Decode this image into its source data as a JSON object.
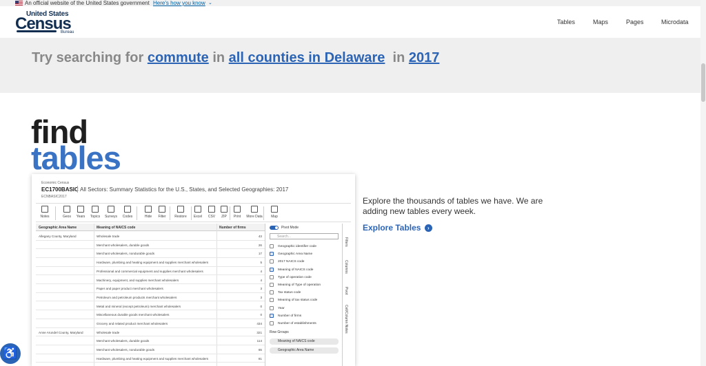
{
  "banner": {
    "text": "An official website of the United States government",
    "link": "Here's how you know",
    "chevron": "⌄"
  },
  "logo": {
    "line1": "United States",
    "line2": "Census",
    "line3": "Bureau"
  },
  "nav": [
    "Tables",
    "Maps",
    "Pages",
    "Microdata"
  ],
  "search_prompt": {
    "prefix": "Try searching for",
    "term": "commute",
    "in1": "in",
    "geo": "all counties in Delaware",
    "in2": "in",
    "year": "2017"
  },
  "hero": {
    "word1": "find",
    "word2": "tables"
  },
  "table_preview": {
    "program": "Economic Census",
    "code": "EC1700BASIC",
    "title": "All Sectors: Summary Statistics for the U.S., States, and Selected Geographies: 2017",
    "subcode": "ECNBASIC2017",
    "toolbar": [
      "Notes",
      "Geos",
      "Years",
      "Topics",
      "Surveys",
      "Codes",
      "Hide",
      "Filter",
      "Restore",
      "Excel",
      "CSV",
      "ZIP",
      "Print",
      "More Data",
      "Map"
    ],
    "columns": [
      "Geographic Area Name",
      "Meaning of NAICS code",
      "Number of firms"
    ],
    "rows": [
      {
        "geo": "Allegany County, Maryland",
        "naics": "Wholesale trade",
        "firms": "43"
      },
      {
        "geo": "",
        "naics": "Merchant wholesalers, durable goods",
        "firms": "26"
      },
      {
        "geo": "",
        "naics": "Merchant wholesalers, nondurable goods",
        "firms": "17"
      },
      {
        "geo": "",
        "naics": "Hardware, plumbing and heating equipment and supplies merchant wholesalers",
        "firms": "5"
      },
      {
        "geo": "",
        "naics": "Professional and commercial equipment and supplies merchant wholesalers",
        "firms": "4"
      },
      {
        "geo": "",
        "naics": "Machinery, equipment, and supplies merchant wholesalers",
        "firms": "4"
      },
      {
        "geo": "",
        "naics": "Paper and paper product merchant wholesalers",
        "firms": "3"
      },
      {
        "geo": "",
        "naics": "Petroleum and petroleum products merchant wholesalers",
        "firms": "3"
      },
      {
        "geo": "",
        "naics": "Metal and mineral (except petroleum) merchant wholesalers",
        "firms": "0"
      },
      {
        "geo": "",
        "naics": "Miscellaneous durable goods merchant wholesalers",
        "firms": "0"
      },
      {
        "geo": "",
        "naics": "Grocery and related product merchant wholesalers",
        "firms": "434"
      },
      {
        "geo": "Anne Arundel County, Maryland",
        "naics": "Wholesale trade",
        "firms": "321"
      },
      {
        "geo": "",
        "naics": "Merchant wholesalers, durable goods",
        "firms": "114"
      },
      {
        "geo": "",
        "naics": "Merchant wholesalers, nondurable goods",
        "firms": "65"
      },
      {
        "geo": "",
        "naics": "Hardware, plumbing and heating equipment and supplies merchant wholesalers",
        "firms": "81"
      }
    ],
    "panel": {
      "pivot": "Pivot Mode",
      "search_placeholder": "Search...",
      "fields": [
        {
          "label": "Geographic identifier code",
          "checked": false
        },
        {
          "label": "Geographic Area Name",
          "checked": true
        },
        {
          "label": "2017 NAICS code",
          "checked": false
        },
        {
          "label": "Meaning of NAICS code",
          "checked": true
        },
        {
          "label": "Type of operation code",
          "checked": false
        },
        {
          "label": "Meaning of Type of operation",
          "checked": false
        },
        {
          "label": "Tax status code",
          "checked": false
        },
        {
          "label": "Meaning of tax status code",
          "checked": false
        },
        {
          "label": "Year",
          "checked": false
        },
        {
          "label": "Number of firms",
          "checked": true
        },
        {
          "label": "Number of establishments",
          "checked": false
        }
      ],
      "row_groups_label": "Row Groups",
      "row_groups": [
        "Meaning of NAICS code",
        "Geographic Area Name"
      ]
    },
    "side_tabs": [
      "Filters",
      "Columns",
      "Pivot",
      "Cell/Column Notes"
    ]
  },
  "explore": {
    "description": "Explore the thousands of tables we have. We are adding new tables every week.",
    "link": "Explore Tables",
    "arrow": "›"
  },
  "accessibility_icon": "accessibility-icon"
}
